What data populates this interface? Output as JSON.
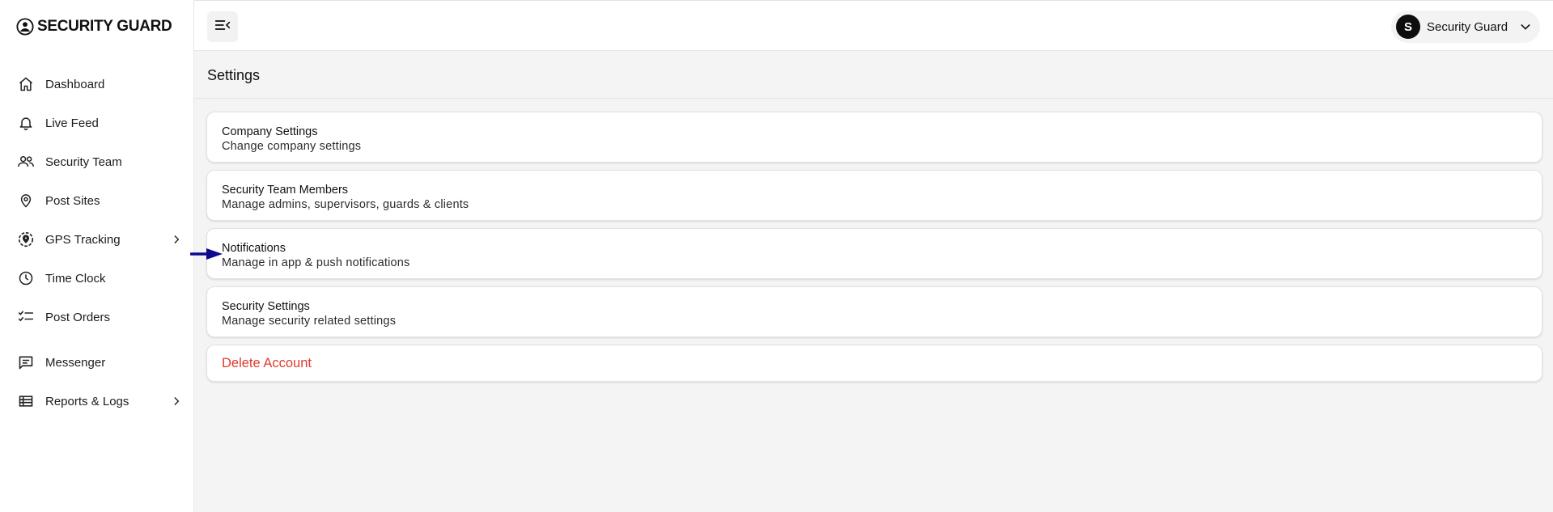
{
  "app": {
    "brand": "SECURITY GUARD"
  },
  "sidebar": {
    "items": [
      {
        "label": "Dashboard",
        "icon": "home-icon"
      },
      {
        "label": "Live Feed",
        "icon": "bell-icon"
      },
      {
        "label": "Security Team",
        "icon": "users-icon"
      },
      {
        "label": "Post Sites",
        "icon": "map-pin-icon"
      },
      {
        "label": "GPS Tracking",
        "icon": "gps-icon",
        "expandable": true
      },
      {
        "label": "Time Clock",
        "icon": "clock-icon"
      },
      {
        "label": "Post Orders",
        "icon": "checklist-icon"
      },
      {
        "label": "Messenger",
        "icon": "message-icon"
      },
      {
        "label": "Reports & Logs",
        "icon": "table-list-icon",
        "expandable": true
      }
    ]
  },
  "header": {
    "user": {
      "initial": "S",
      "name": "Security Guard"
    }
  },
  "main": {
    "title": "Settings",
    "cards": [
      {
        "title": "Company Settings",
        "description": "Change company settings"
      },
      {
        "title": "Security Team Members",
        "description": "Manage admins, supervisors, guards & clients"
      },
      {
        "title": "Notifications",
        "description": "Manage in app & push notifications"
      },
      {
        "title": "Security Settings",
        "description": "Manage security related settings"
      }
    ],
    "delete_label": "Delete Account"
  },
  "colors": {
    "danger": "#e03b2e",
    "arrow": "#0b0b8c",
    "background": "#f4f4f4"
  }
}
